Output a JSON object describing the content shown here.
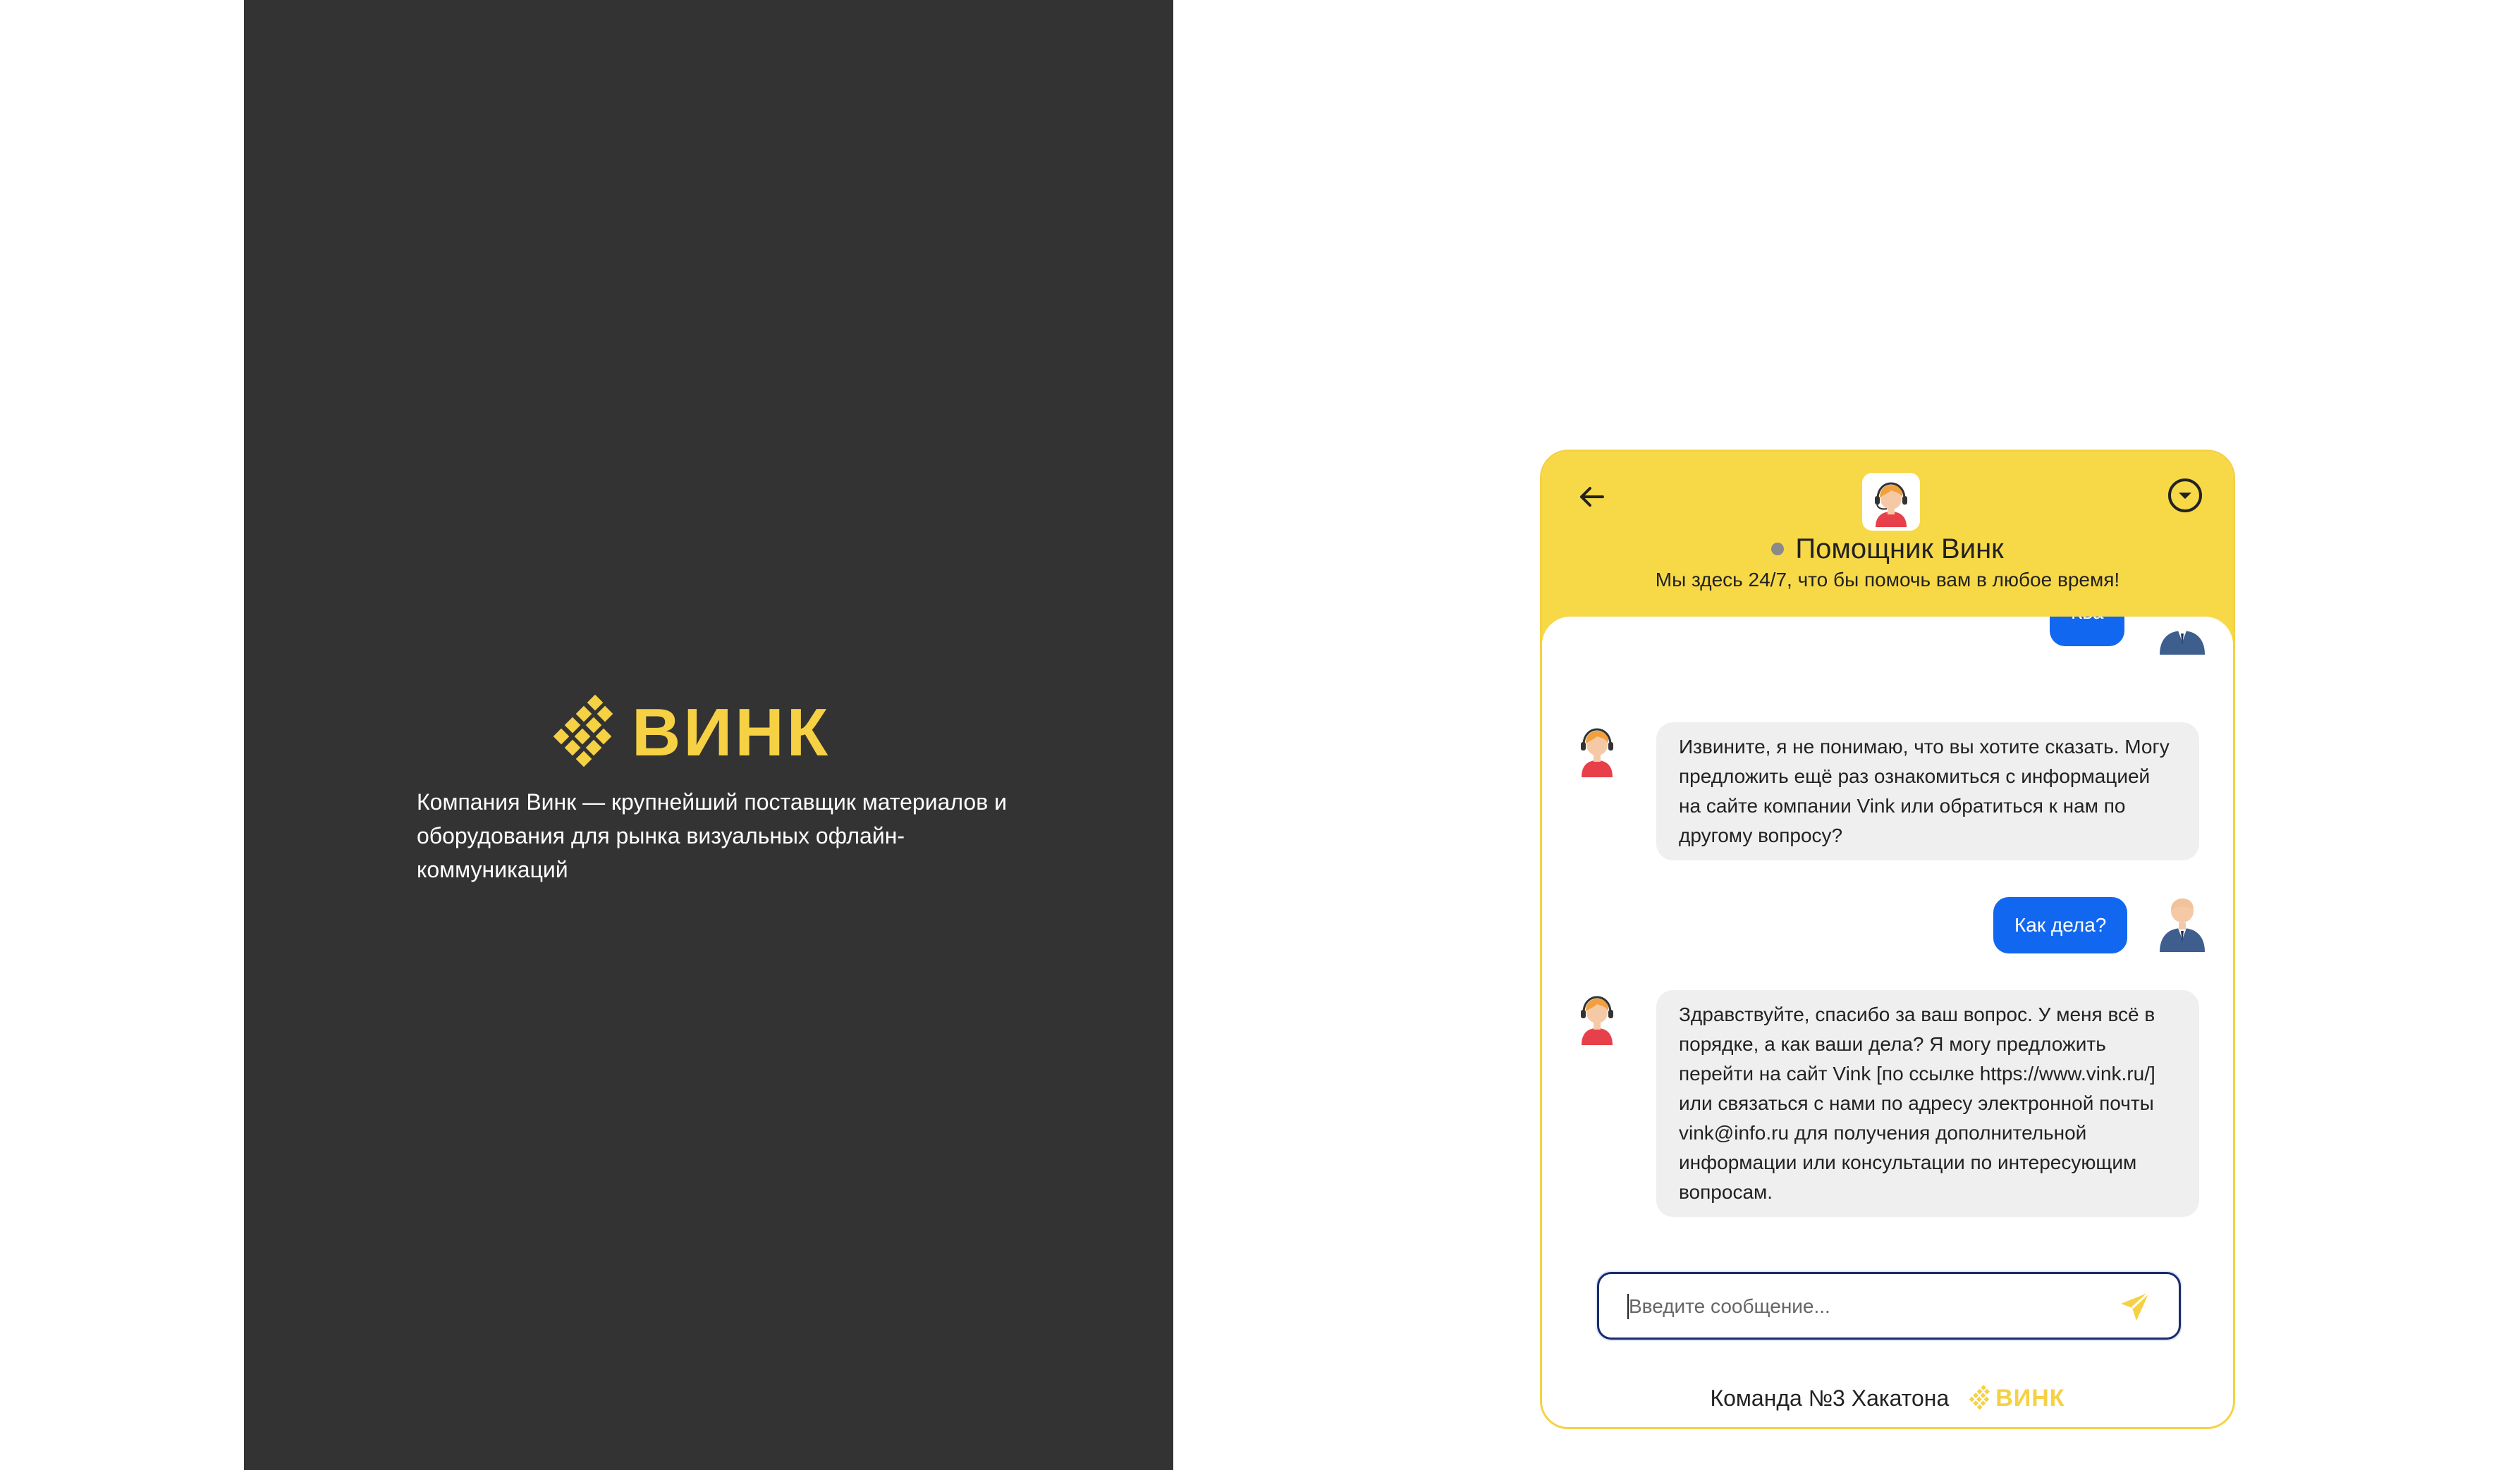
{
  "brand": {
    "name": "ВИНК",
    "description": "Компания Винк — крупнейший поставщик материалов и оборудования для рынка визуальных офлайн-коммуникаций",
    "color": "#f5d143"
  },
  "chat": {
    "header": {
      "title": "Помощник Винк",
      "subtitle": "Мы здесь 24/7, что бы помочь вам в любое время!",
      "back_icon": "arrow-left-icon",
      "collapse_icon": "chevron-circle-down-icon",
      "bg_color": "#f7d847"
    },
    "messages": [
      {
        "from": "user",
        "text": "Ква"
      },
      {
        "from": "bot",
        "text": "Извините, я не понимаю, что вы хотите сказать. Могу предложить ещё раз ознакомиться с информацией на сайте компании Vink или обратиться к нам по другому вопросу?"
      },
      {
        "from": "user",
        "text": "Как дела?"
      },
      {
        "from": "bot",
        "text": "Здравствуйте, спасибо за ваш вопрос. У меня всё в порядке, а как ваши дела? Я могу предложить перейти на сайт Vink [по ссылке https://www.vink.ru/] или связаться с нами по адресу электронной почты vink@info.ru для получения дополнительной информации или консультации по интересующим вопросам."
      }
    ],
    "input": {
      "placeholder": "Введите сообщение...",
      "value": ""
    },
    "send_icon": "send-icon",
    "footer": {
      "text": "Команда №3 Хакатона",
      "logo": "ВИНК"
    },
    "user_bubble_color": "#1167f0",
    "bot_bubble_color": "#efefef"
  }
}
